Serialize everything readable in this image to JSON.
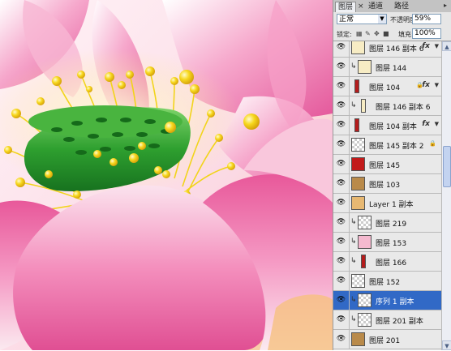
{
  "tabs": [
    {
      "label": "图层",
      "active": true
    },
    {
      "label": "通道",
      "active": false
    },
    {
      "label": "路径",
      "active": false
    }
  ],
  "tab_close": "×",
  "menu_icon": "▸",
  "options": {
    "blend_mode": "正常",
    "opacity_label": "不透明度:",
    "opacity_value": "59%",
    "lock_label": "锁定:",
    "fill_label": "填充:",
    "fill_value": "100%"
  },
  "layers": [
    {
      "name": "图层 146 副本 6",
      "fx": true,
      "thumb": "cream",
      "clip": false
    },
    {
      "name": "图层 144",
      "clip": true,
      "thumb": "cream"
    },
    {
      "name": "图层 104",
      "fx": true,
      "lock": true,
      "thumb": "red-strip"
    },
    {
      "name": "图层 146 副本 6",
      "clip": true,
      "thumb": "cream-strip"
    },
    {
      "name": "图层 104 副本",
      "fx": true,
      "thumb": "red-strip"
    },
    {
      "name": "图层 145 副本 2",
      "lock": true,
      "thumb": "trans"
    },
    {
      "name": "图层 145",
      "thumb": "red"
    },
    {
      "name": "图层 103",
      "thumb": "brown"
    },
    {
      "name": "Layer 1 副本",
      "thumb": "orange"
    },
    {
      "name": "图层 219",
      "clip": true,
      "thumb": "trans"
    },
    {
      "name": "图层 153",
      "clip": true,
      "thumb": "pink"
    },
    {
      "name": "图层 166",
      "clip": true,
      "thumb": "red-strip"
    },
    {
      "name": "图层 152",
      "thumb": "trans"
    },
    {
      "name": "序列 1 副本",
      "clip": true,
      "selected": true,
      "thumb": "trans"
    },
    {
      "name": "图层 201 副本",
      "clip": true,
      "thumb": "trans"
    },
    {
      "name": "图层 201",
      "thumb": "brown"
    }
  ],
  "icons": {
    "eye": "eye-icon",
    "clip": "clip-arrow-icon",
    "fx": "fx",
    "lock": "lock-icon"
  },
  "colors": {
    "selection": "#3169c6",
    "petal_pink": "#e8589a",
    "seedpod_green": "#1f9a2a",
    "stamen_yellow": "#f5d51a"
  }
}
